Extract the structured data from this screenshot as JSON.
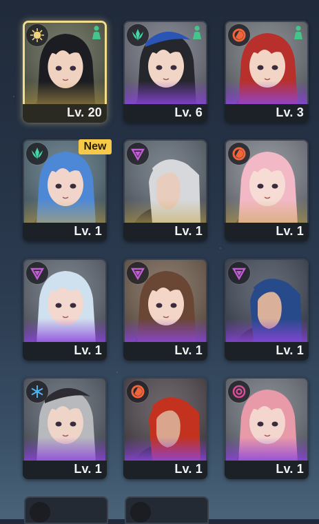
{
  "colors": {
    "selected_border": "#f2dd8f",
    "new_badge": "#f7c948",
    "rarity_4": "#8c46dc",
    "rarity_5": "#c8aa50"
  },
  "new_badge": "New",
  "characters": [
    {
      "level": "Lv. 20",
      "element": "spectro-icon",
      "role": "support-icon",
      "selected": true,
      "rarity": "gold",
      "hair": "#1c1d22",
      "skin": "#f0d2c0",
      "bg": "#555b48"
    },
    {
      "level": "Lv. 6",
      "element": "aero-icon",
      "role": "support-icon",
      "selected": false,
      "rarity": "purple",
      "hair": "#26262d",
      "skin": "#f1d5c6",
      "bg": "#6b6f7c",
      "hat": "#2a55b4"
    },
    {
      "level": "Lv. 3",
      "element": "fusion-icon",
      "role": "support-icon",
      "selected": false,
      "rarity": "purple",
      "hair": "#b8302c",
      "skin": "#f3d5c5",
      "bg": "#6c7278"
    },
    {
      "level": "Lv. 1",
      "element": "aero-icon",
      "role": "",
      "selected": false,
      "rarity": "gold",
      "hair": "#4d88d6",
      "skin": "#f1d5cb",
      "bg": "#4f6a78",
      "isNew": true
    },
    {
      "level": "Lv. 1",
      "element": "havoc-icon",
      "role": "",
      "selected": false,
      "rarity": "gold",
      "hair": "#d6d8dc",
      "skin": "#e8ccbd",
      "bg": "#5c6672"
    },
    {
      "level": "Lv. 1",
      "element": "fusion-icon",
      "role": "",
      "selected": false,
      "rarity": "gold",
      "hair": "#f3b8c6",
      "skin": "#f6dcd4",
      "bg": "#7a7f88"
    },
    {
      "level": "Lv. 1",
      "element": "havoc-icon",
      "role": "",
      "selected": false,
      "rarity": "purple",
      "hair": "#cfe0ee",
      "skin": "#f2d8ce",
      "bg": "#5c6470"
    },
    {
      "level": "Lv. 1",
      "element": "havoc-icon",
      "role": "",
      "selected": false,
      "rarity": "purple",
      "hair": "#6a4634",
      "skin": "#f3d6c7",
      "bg": "#705b4b"
    },
    {
      "level": "Lv. 1",
      "element": "havoc-icon",
      "role": "",
      "selected": false,
      "rarity": "purple",
      "hair": "#274a8a",
      "skin": "#d9b19a",
      "bg": "#3e4656"
    },
    {
      "level": "Lv. 1",
      "element": "glacio-icon",
      "role": "",
      "selected": false,
      "rarity": "purple",
      "hair": "#b8b9bd",
      "skin": "#efd4c8",
      "bg": "#545c68",
      "hat": "#2c2c32"
    },
    {
      "level": "Lv. 1",
      "element": "fusion-icon",
      "role": "",
      "selected": false,
      "rarity": "purple",
      "hair": "#c2321f",
      "skin": "#d9a58d",
      "bg": "#4a4148"
    },
    {
      "level": "Lv. 1",
      "element": "electro-icon",
      "role": "",
      "selected": false,
      "rarity": "purple",
      "hair": "#e99aa8",
      "skin": "#f3d6cd",
      "bg": "#6b707a"
    }
  ]
}
